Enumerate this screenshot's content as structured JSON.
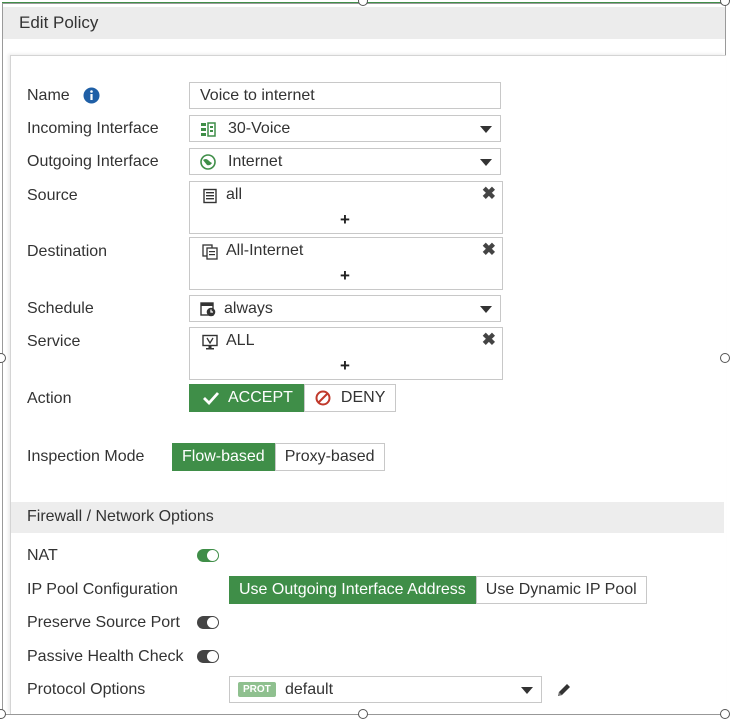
{
  "dialog": {
    "title": "Edit Policy"
  },
  "form": {
    "name_label": "Name",
    "name_value": "Voice to internet",
    "incoming_label": "Incoming Interface",
    "incoming_value": "30-Voice",
    "outgoing_label": "Outgoing Interface",
    "outgoing_value": "Internet",
    "source_label": "Source",
    "source_value": "all",
    "destination_label": "Destination",
    "destination_value": "All-Internet",
    "schedule_label": "Schedule",
    "schedule_value": "always",
    "service_label": "Service",
    "service_value": "ALL",
    "add_symbol": "+",
    "remove_symbol": "✖",
    "action_label": "Action",
    "action_accept": "ACCEPT",
    "action_deny": "DENY",
    "inspection_label": "Inspection Mode",
    "inspection_flow": "Flow-based",
    "inspection_proxy": "Proxy-based"
  },
  "firewall_section": {
    "title": "Firewall / Network Options",
    "nat_label": "NAT",
    "nat_enabled": true,
    "ippool_label": "IP Pool Configuration",
    "ippool_outgoing": "Use Outgoing Interface Address",
    "ippool_dynamic": "Use Dynamic IP Pool",
    "preserve_label": "Preserve Source Port",
    "preserve_enabled": false,
    "passive_label": "Passive Health Check",
    "passive_enabled": false,
    "protocol_label": "Protocol Options",
    "protocol_badge": "PROT",
    "protocol_value": "default"
  },
  "colors": {
    "accent": "#3f8e48",
    "info": "#1f5fa6",
    "deny": "#c0392b"
  },
  "icons": [
    "info-icon",
    "interface-icon",
    "globe-icon",
    "address-icon",
    "address-group-icon",
    "schedule-icon",
    "service-icon",
    "check-icon",
    "deny-icon",
    "edit-icon",
    "remove-icon",
    "caret-down-icon"
  ]
}
